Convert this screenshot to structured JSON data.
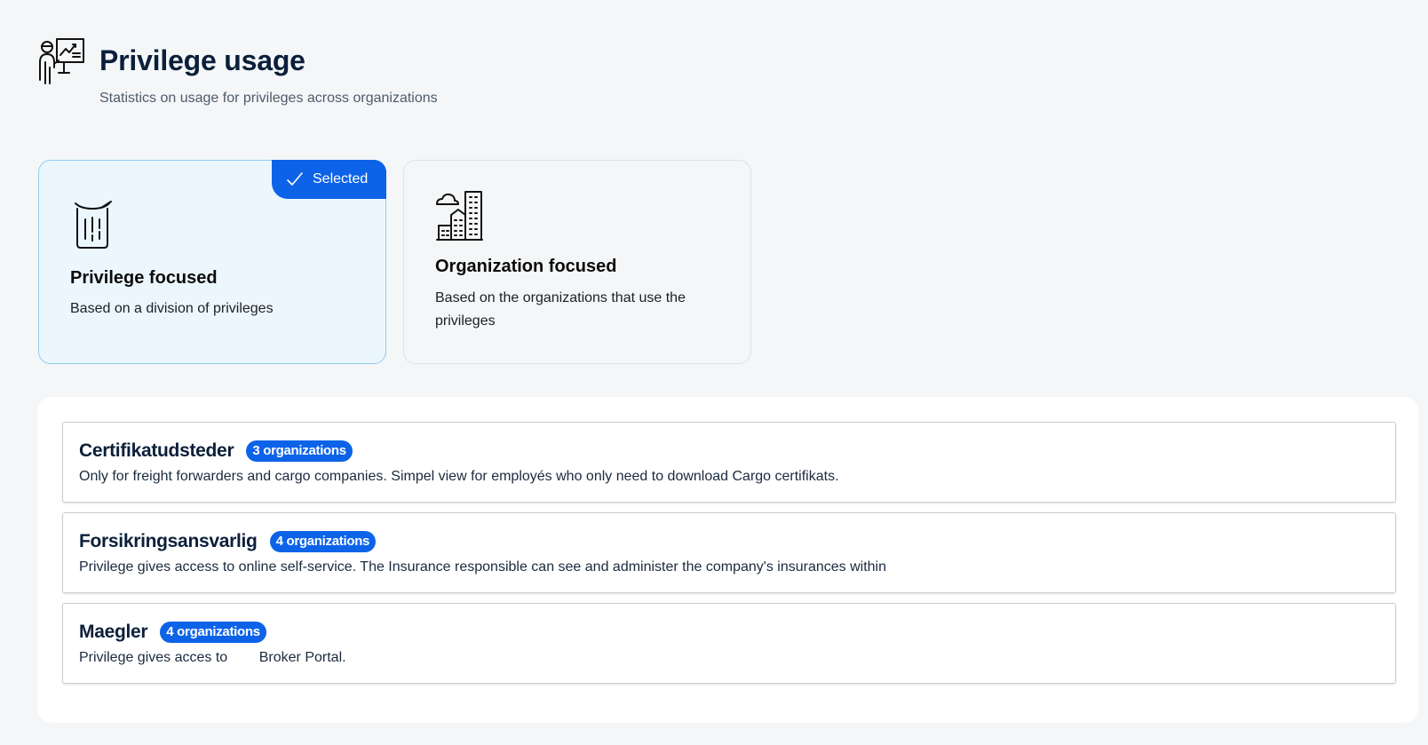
{
  "page": {
    "title": "Privilege usage",
    "subtitle": "Statistics on usage for privileges across organizations",
    "icon": "presenter-icon"
  },
  "view_options": [
    {
      "title": "Privilege focused",
      "description": "Based on a division of privileges",
      "icon": "trash-bin-icon",
      "selected": true,
      "selected_label": "Selected"
    },
    {
      "title": "Organization focused",
      "description": "Based on the organizations that use the privileges",
      "icon": "city-buildings-icon",
      "selected": false
    }
  ],
  "privileges": [
    {
      "name": "Certifikatudsteder",
      "badge": "3 organizations",
      "description": "Only for freight forwarders and cargo companies. Simpel view for employés who only need to download Cargo certifikats."
    },
    {
      "name": "Forsikringsansvarlig",
      "badge": "4 organizations",
      "description": "Privilege gives access to online self-service. The Insurance responsible can see and administer the company's insurances within"
    },
    {
      "name": "Maegler",
      "badge": "4 organizations",
      "description": "Privilege gives acces to        Broker Portal."
    }
  ],
  "colors": {
    "accent": "#0d63e8",
    "selected_bg": "#ecf7fd",
    "selected_border": "#8fcdee",
    "page_bg": "#f4f6f8",
    "title": "#0b1f3a"
  }
}
